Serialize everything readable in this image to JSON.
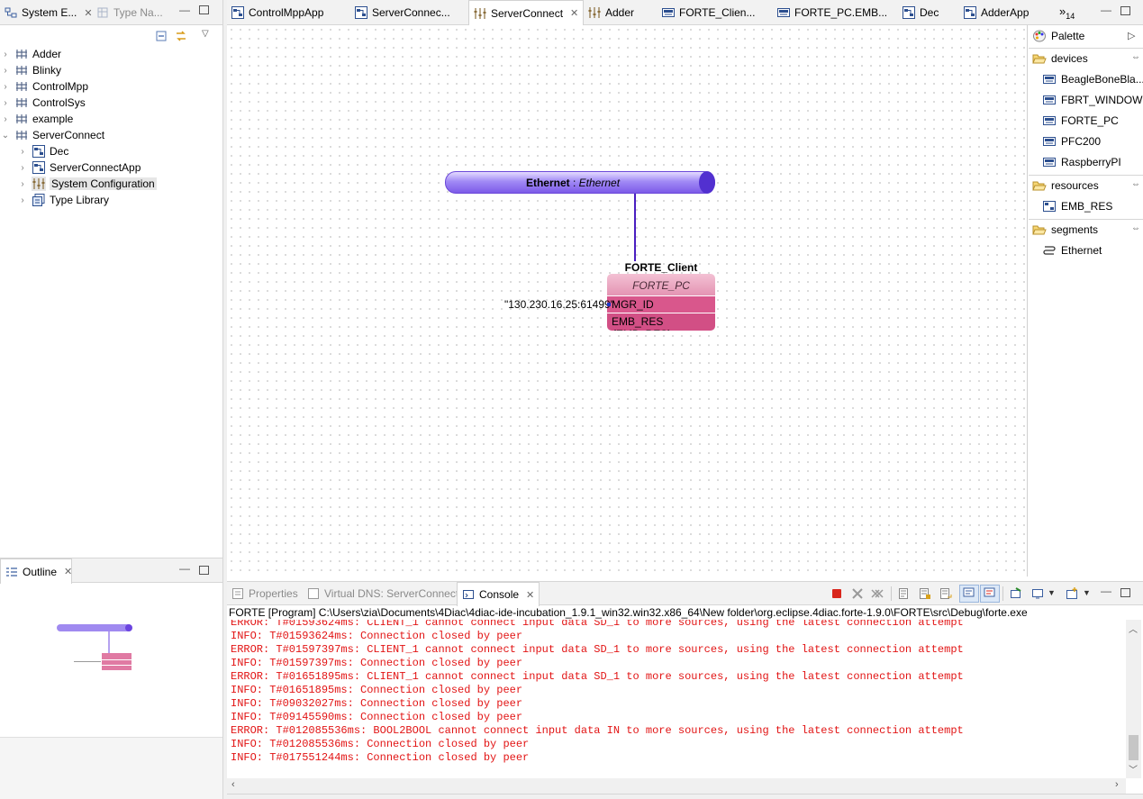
{
  "left_panel": {
    "tabs": [
      {
        "label": "System E...",
        "active": true
      },
      {
        "label": "Type Na...",
        "active": false
      }
    ],
    "tree": [
      {
        "label": "Adder",
        "icon": "system-icon",
        "expanded": false
      },
      {
        "label": "Blinky",
        "icon": "system-icon",
        "expanded": false
      },
      {
        "label": "ControlMpp",
        "icon": "system-icon",
        "expanded": false
      },
      {
        "label": "ControlSys",
        "icon": "system-icon",
        "expanded": false
      },
      {
        "label": "example",
        "icon": "system-icon",
        "expanded": false
      },
      {
        "label": "ServerConnect",
        "icon": "system-icon",
        "expanded": true,
        "children": [
          {
            "label": "Dec",
            "icon": "application-icon"
          },
          {
            "label": "ServerConnectApp",
            "icon": "application-icon"
          },
          {
            "label": "System Configuration",
            "icon": "sysconf-icon",
            "selected": true
          },
          {
            "label": "Type Library",
            "icon": "typelib-icon"
          }
        ]
      }
    ]
  },
  "outline": {
    "title": "Outline"
  },
  "editor_tabs": [
    {
      "label": "ControlMppApp",
      "icon": "application-icon"
    },
    {
      "label": "ServerConnec...",
      "icon": "application-icon"
    },
    {
      "label": "ServerConnect",
      "icon": "sysconf-icon",
      "active": true
    },
    {
      "label": "Adder",
      "icon": "sysconf-icon"
    },
    {
      "label": "FORTE_Clien...",
      "icon": "device-icon"
    },
    {
      "label": "FORTE_PC.EMB...",
      "icon": "device-icon"
    },
    {
      "label": "Dec",
      "icon": "application-icon"
    },
    {
      "label": "AdderApp",
      "icon": "application-icon"
    }
  ],
  "overflow_tabs": {
    "label": "»",
    "count": "14"
  },
  "diagram": {
    "segment": {
      "name": "Ethernet",
      "type": "Ethernet",
      "separator": ":"
    },
    "device": {
      "instance": "FORTE_Client",
      "type": "FORTE_PC",
      "param_value": "\"130.230.16.25:61499\"",
      "param_name": "MGR_ID",
      "resource": "EMB_RES",
      "resource_type": "(EMB_RES)"
    }
  },
  "palette": {
    "title": "Palette",
    "groups": [
      {
        "label": "devices",
        "items": [
          "BeagleBoneBla...",
          "FBRT_WINDOW",
          "FORTE_PC",
          "PFC200",
          "RaspberryPI"
        ]
      },
      {
        "label": "resources",
        "items": [
          "EMB_RES"
        ]
      },
      {
        "label": "segments",
        "items": [
          "Ethernet"
        ]
      }
    ]
  },
  "bottom_tabs": [
    {
      "label": "Properties",
      "active": false
    },
    {
      "label": "Virtual DNS: ServerConnect",
      "active": false
    },
    {
      "label": "Console",
      "active": true
    }
  ],
  "console": {
    "header": "FORTE [Program] C:\\Users\\zia\\Documents\\4Diac\\4diac-ide-incubation_1.9.1_win32.win32.x86_64\\New folder\\org.eclipse.4diac.forte-1.9.0\\FORTE\\src\\Debug\\forte.exe",
    "lines": [
      "ERROR: T#01593624ms: CLIENT_1 cannot connect input data SD_1 to more sources, using the latest connection attempt",
      "INFO: T#01593624ms: Connection closed by peer",
      "ERROR: T#01597397ms: CLIENT_1 cannot connect input data SD_1 to more sources, using the latest connection attempt",
      "INFO: T#01597397ms: Connection closed by peer",
      "ERROR: T#01651895ms: CLIENT_1 cannot connect input data SD_1 to more sources, using the latest connection attempt",
      "INFO: T#01651895ms: Connection closed by peer",
      "INFO: T#09032027ms: Connection closed by peer",
      "INFO: T#09145590ms: Connection closed by peer",
      "ERROR: T#012085536ms: BOOL2BOOL cannot connect input data IN to more sources, using the latest connection attempt",
      "INFO: T#012085536ms: Connection closed by peer",
      "INFO: T#017551244ms: Connection closed by peer"
    ]
  },
  "colors": {
    "segment": "#7b57e8",
    "device": "#d85a8a",
    "console_error": "#e21414"
  }
}
